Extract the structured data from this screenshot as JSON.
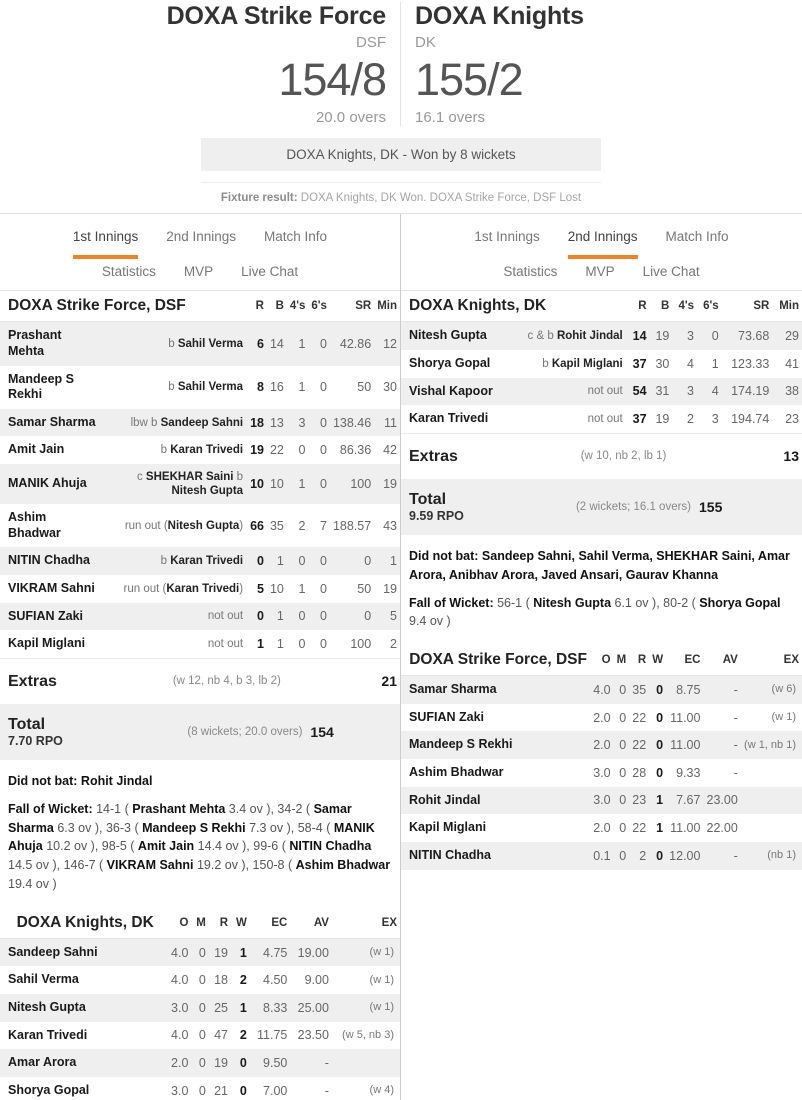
{
  "header": {
    "team_a": {
      "name": "DOXA Strike Force",
      "abbr": "DSF",
      "score": "154/8",
      "overs": "20.0 overs"
    },
    "team_b": {
      "name": "DOXA Knights",
      "abbr": "DK",
      "score": "155/2",
      "overs": "16.1 overs"
    },
    "result_banner": "DOXA Knights, DK - Won by 8 wickets",
    "fixture_label": "Fixture result:",
    "fixture_text": " DOXA Knights, DK Won. DOXA Strike Force, DSF Lost"
  },
  "accent_color": "#f58220",
  "tabs": {
    "left": {
      "row1": [
        "1st Innings",
        "2nd Innings",
        "Match Info"
      ],
      "row2": [
        "Statistics",
        "MVP",
        "Live Chat"
      ],
      "active": "1st Innings"
    },
    "right": {
      "row1": [
        "1st Innings",
        "2nd Innings",
        "Match Info"
      ],
      "row2": [
        "Statistics",
        "MVP",
        "Live Chat"
      ],
      "active": "2nd Innings"
    }
  },
  "bat_columns": [
    "R",
    "B",
    "4's",
    "6's",
    "SR",
    "Min"
  ],
  "bowl_columns": [
    "O",
    "M",
    "R",
    "W",
    "EC",
    "AV",
    "EX"
  ],
  "left_panel": {
    "batting_title": "DOXA Strike Force, DSF",
    "batsmen": [
      {
        "name": "Prashant Mehta",
        "dis_pre": "b ",
        "dis_bold": "Sahil Verma",
        "dis_post": "",
        "r": "6",
        "b": "14",
        "f": "1",
        "s": "0",
        "sr": "42.86",
        "min": "12"
      },
      {
        "name": "Mandeep S Rekhi",
        "dis_pre": "b ",
        "dis_bold": "Sahil Verma",
        "dis_post": "",
        "r": "8",
        "b": "16",
        "f": "1",
        "s": "0",
        "sr": "50",
        "min": "30"
      },
      {
        "name": "Samar Sharma",
        "dis_pre": "lbw b ",
        "dis_bold": "Sandeep Sahni",
        "dis_post": "",
        "r": "18",
        "b": "13",
        "f": "3",
        "s": "0",
        "sr": "138.46",
        "min": "11"
      },
      {
        "name": "Amit Jain",
        "dis_pre": "b ",
        "dis_bold": "Karan Trivedi",
        "dis_post": "",
        "r": "19",
        "b": "22",
        "f": "0",
        "s": "0",
        "sr": "86.36",
        "min": "42"
      },
      {
        "name": "MANIK Ahuja",
        "dis_pre": "c ",
        "dis_bold": "SHEKHAR Saini",
        "dis_post": "",
        "dis_pre2": " b ",
        "dis_bold2": "Nitesh Gupta",
        "r": "10",
        "b": "10",
        "f": "1",
        "s": "0",
        "sr": "100",
        "min": "19"
      },
      {
        "name": "Ashim Bhadwar",
        "dis_pre": "run out (",
        "dis_bold": "Nitesh Gupta",
        "dis_post": ")",
        "r": "66",
        "b": "35",
        "f": "2",
        "s": "7",
        "sr": "188.57",
        "min": "43"
      },
      {
        "name": "NITIN Chadha",
        "dis_pre": "b ",
        "dis_bold": "Karan Trivedi",
        "dis_post": "",
        "r": "0",
        "b": "1",
        "f": "0",
        "s": "0",
        "sr": "0",
        "min": "1"
      },
      {
        "name": "VIKRAM Sahni",
        "dis_pre": "run out (",
        "dis_bold": "Karan Trivedi",
        "dis_post": ")",
        "r": "5",
        "b": "10",
        "f": "1",
        "s": "0",
        "sr": "50",
        "min": "19"
      },
      {
        "name": "SUFIAN Zaki",
        "dis_pre": "not out",
        "dis_bold": "",
        "dis_post": "",
        "r": "0",
        "b": "1",
        "f": "0",
        "s": "0",
        "sr": "0",
        "min": "5"
      },
      {
        "name": "Kapil Miglani",
        "dis_pre": "not out",
        "dis_bold": "",
        "dis_post": "",
        "r": "1",
        "b": "1",
        "f": "0",
        "s": "0",
        "sr": "100",
        "min": "2"
      }
    ],
    "extras_label": "Extras",
    "extras_detail": "(w 12, nb 4, b 3, lb 2)",
    "extras_value": "21",
    "total_label": "Total",
    "total_rpo": "7.70 RPO",
    "total_detail": "(8 wickets; 20.0 overs)",
    "total_value": "154",
    "dnb_label": "Did not bat:",
    "dnb_text": " Rohit Jindal",
    "fow_label": "Fall of Wicket:",
    "fow_parts": [
      {
        "t": " 14-1 ( ",
        "bold": false
      },
      {
        "t": "Prashant Mehta",
        "bold": true
      },
      {
        "t": " 3.4 ov ), 34-2 ( ",
        "bold": false
      },
      {
        "t": "Samar Sharma",
        "bold": true
      },
      {
        "t": " 6.3 ov ), 36-3 ( ",
        "bold": false
      },
      {
        "t": "Mandeep S Rekhi",
        "bold": true
      },
      {
        "t": " 7.3 ov ), 58-4 ( ",
        "bold": false
      },
      {
        "t": "MANIK Ahuja",
        "bold": true
      },
      {
        "t": " 10.2 ov ), 98-5 ( ",
        "bold": false
      },
      {
        "t": "Amit Jain",
        "bold": true
      },
      {
        "t": " 14.4 ov ), 99-6 ( ",
        "bold": false
      },
      {
        "t": "NITIN Chadha",
        "bold": true
      },
      {
        "t": " 14.5 ov ), 146-7 ( ",
        "bold": false
      },
      {
        "t": "VIKRAM Sahni",
        "bold": true
      },
      {
        "t": " 19.2 ov ), 150-8 ( ",
        "bold": false
      },
      {
        "t": "Ashim Bhadwar",
        "bold": true
      },
      {
        "t": " 19.4 ov )",
        "bold": false
      }
    ],
    "bowling_title": "DOXA Knights, DK",
    "bowlers": [
      {
        "name": "Sandeep Sahni",
        "o": "4.0",
        "m": "0",
        "r": "19",
        "w": "1",
        "ec": "4.75",
        "av": "19.00",
        "ex": "(w 1)"
      },
      {
        "name": "Sahil Verma",
        "o": "4.0",
        "m": "0",
        "r": "18",
        "w": "2",
        "ec": "4.50",
        "av": "9.00",
        "ex": "(w 1)"
      },
      {
        "name": "Nitesh Gupta",
        "o": "3.0",
        "m": "0",
        "r": "25",
        "w": "1",
        "ec": "8.33",
        "av": "25.00",
        "ex": "(w 1)"
      },
      {
        "name": "Karan Trivedi",
        "o": "4.0",
        "m": "0",
        "r": "47",
        "w": "2",
        "ec": "11.75",
        "av": "23.50",
        "ex": "(w 5, nb 3)"
      },
      {
        "name": "Amar Arora",
        "o": "2.0",
        "m": "0",
        "r": "19",
        "w": "0",
        "ec": "9.50",
        "av": "-",
        "ex": ""
      },
      {
        "name": "Shorya Gopal",
        "o": "3.0",
        "m": "0",
        "r": "21",
        "w": "0",
        "ec": "7.00",
        "av": "-",
        "ex": "(w 4)"
      }
    ]
  },
  "right_panel": {
    "batting_title": "DOXA Knights, DK",
    "batsmen": [
      {
        "name": "Nitesh Gupta",
        "dis_pre": "c & b ",
        "dis_bold": "Rohit Jindal",
        "dis_post": "",
        "r": "14",
        "b": "19",
        "f": "3",
        "s": "0",
        "sr": "73.68",
        "min": "29"
      },
      {
        "name": "Shorya Gopal",
        "dis_pre": "b ",
        "dis_bold": "Kapil Miglani",
        "dis_post": "",
        "r": "37",
        "b": "30",
        "f": "4",
        "s": "1",
        "sr": "123.33",
        "min": "41"
      },
      {
        "name": "Vishal Kapoor",
        "dis_pre": "not out",
        "dis_bold": "",
        "dis_post": "",
        "r": "54",
        "b": "31",
        "f": "3",
        "s": "4",
        "sr": "174.19",
        "min": "38"
      },
      {
        "name": "Karan Trivedi",
        "dis_pre": "not out",
        "dis_bold": "",
        "dis_post": "",
        "r": "37",
        "b": "19",
        "f": "2",
        "s": "3",
        "sr": "194.74",
        "min": "23"
      }
    ],
    "extras_label": "Extras",
    "extras_detail": "(w 10, nb 2, lb 1)",
    "extras_value": "13",
    "total_label": "Total",
    "total_rpo": "9.59 RPO",
    "total_detail": "(2 wickets; 16.1 overs)",
    "total_value": "155",
    "dnb_label": "Did not bat:",
    "dnb_text": " Sandeep Sahni, Sahil Verma, SHEKHAR Saini, Amar Arora, Anibhav Arora, Javed Ansari, Gaurav Khanna",
    "fow_label": "Fall of Wicket:",
    "fow_parts": [
      {
        "t": " 56-1 ( ",
        "bold": false
      },
      {
        "t": "Nitesh Gupta",
        "bold": true
      },
      {
        "t": " 6.1 ov ), 80-2 ( ",
        "bold": false
      },
      {
        "t": "Shorya Gopal",
        "bold": true
      },
      {
        "t": " 9.4 ov )",
        "bold": false
      }
    ],
    "bowling_title": "DOXA Strike Force, DSF",
    "bowlers": [
      {
        "name": "Samar Sharma",
        "o": "4.0",
        "m": "0",
        "r": "35",
        "w": "0",
        "ec": "8.75",
        "av": "-",
        "ex": "(w 6)"
      },
      {
        "name": "SUFIAN Zaki",
        "o": "2.0",
        "m": "0",
        "r": "22",
        "w": "0",
        "ec": "11.00",
        "av": "-",
        "ex": "(w 1)"
      },
      {
        "name": "Mandeep S Rekhi",
        "o": "2.0",
        "m": "0",
        "r": "22",
        "w": "0",
        "ec": "11.00",
        "av": "-",
        "ex": "(w 1, nb 1)"
      },
      {
        "name": "Ashim Bhadwar",
        "o": "3.0",
        "m": "0",
        "r": "28",
        "w": "0",
        "ec": "9.33",
        "av": "-",
        "ex": ""
      },
      {
        "name": "Rohit Jindal",
        "o": "3.0",
        "m": "0",
        "r": "23",
        "w": "1",
        "ec": "7.67",
        "av": "23.00",
        "ex": ""
      },
      {
        "name": "Kapil Miglani",
        "o": "2.0",
        "m": "0",
        "r": "22",
        "w": "1",
        "ec": "11.00",
        "av": "22.00",
        "ex": ""
      },
      {
        "name": "NITIN Chadha",
        "o": "0.1",
        "m": "0",
        "r": "2",
        "w": "0",
        "ec": "12.00",
        "av": "-",
        "ex": "(nb 1)"
      }
    ]
  }
}
